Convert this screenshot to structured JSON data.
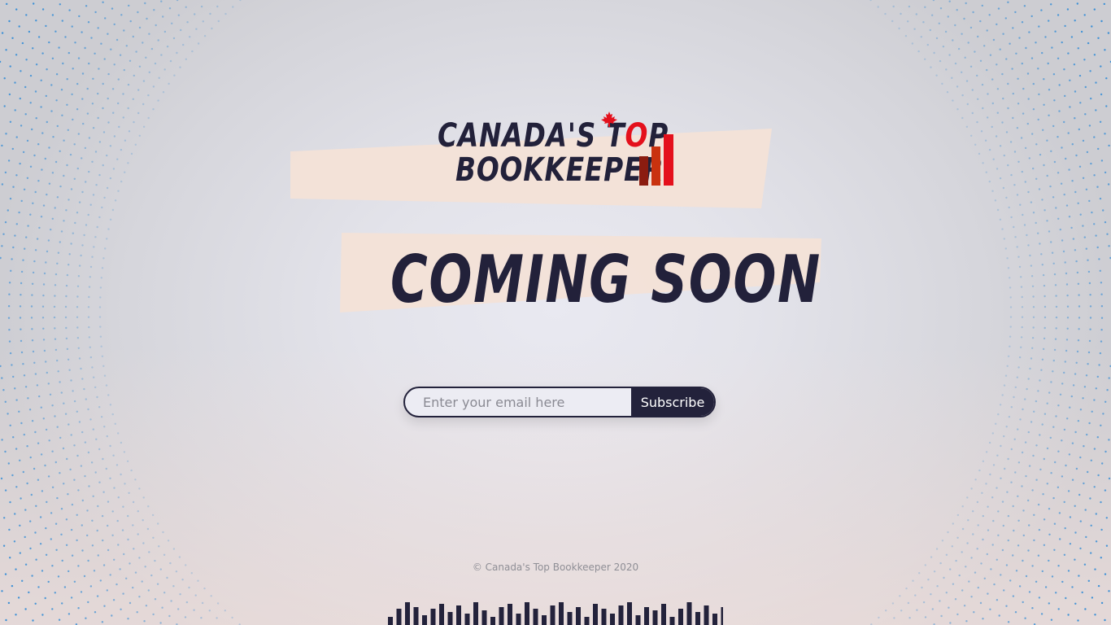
{
  "logo": {
    "line1_prefix": "CANADA'S T",
    "line1_o": "O",
    "line1_suffix": "P",
    "line2": "BOOKKEEPER",
    "icon": "maple-leaf-icon",
    "bars_icon": "bar-chart-icon"
  },
  "headline": "COMING SOON",
  "subscribe": {
    "placeholder": "Enter your email here",
    "button_label": "Subscribe"
  },
  "footer": {
    "copyright": "© Canada's Top Bookkeeper 2020"
  },
  "colors": {
    "navy": "#23223b",
    "red": "#e4101c",
    "band": "#f5e2d8",
    "dot_blue": "#3a8fd6"
  }
}
